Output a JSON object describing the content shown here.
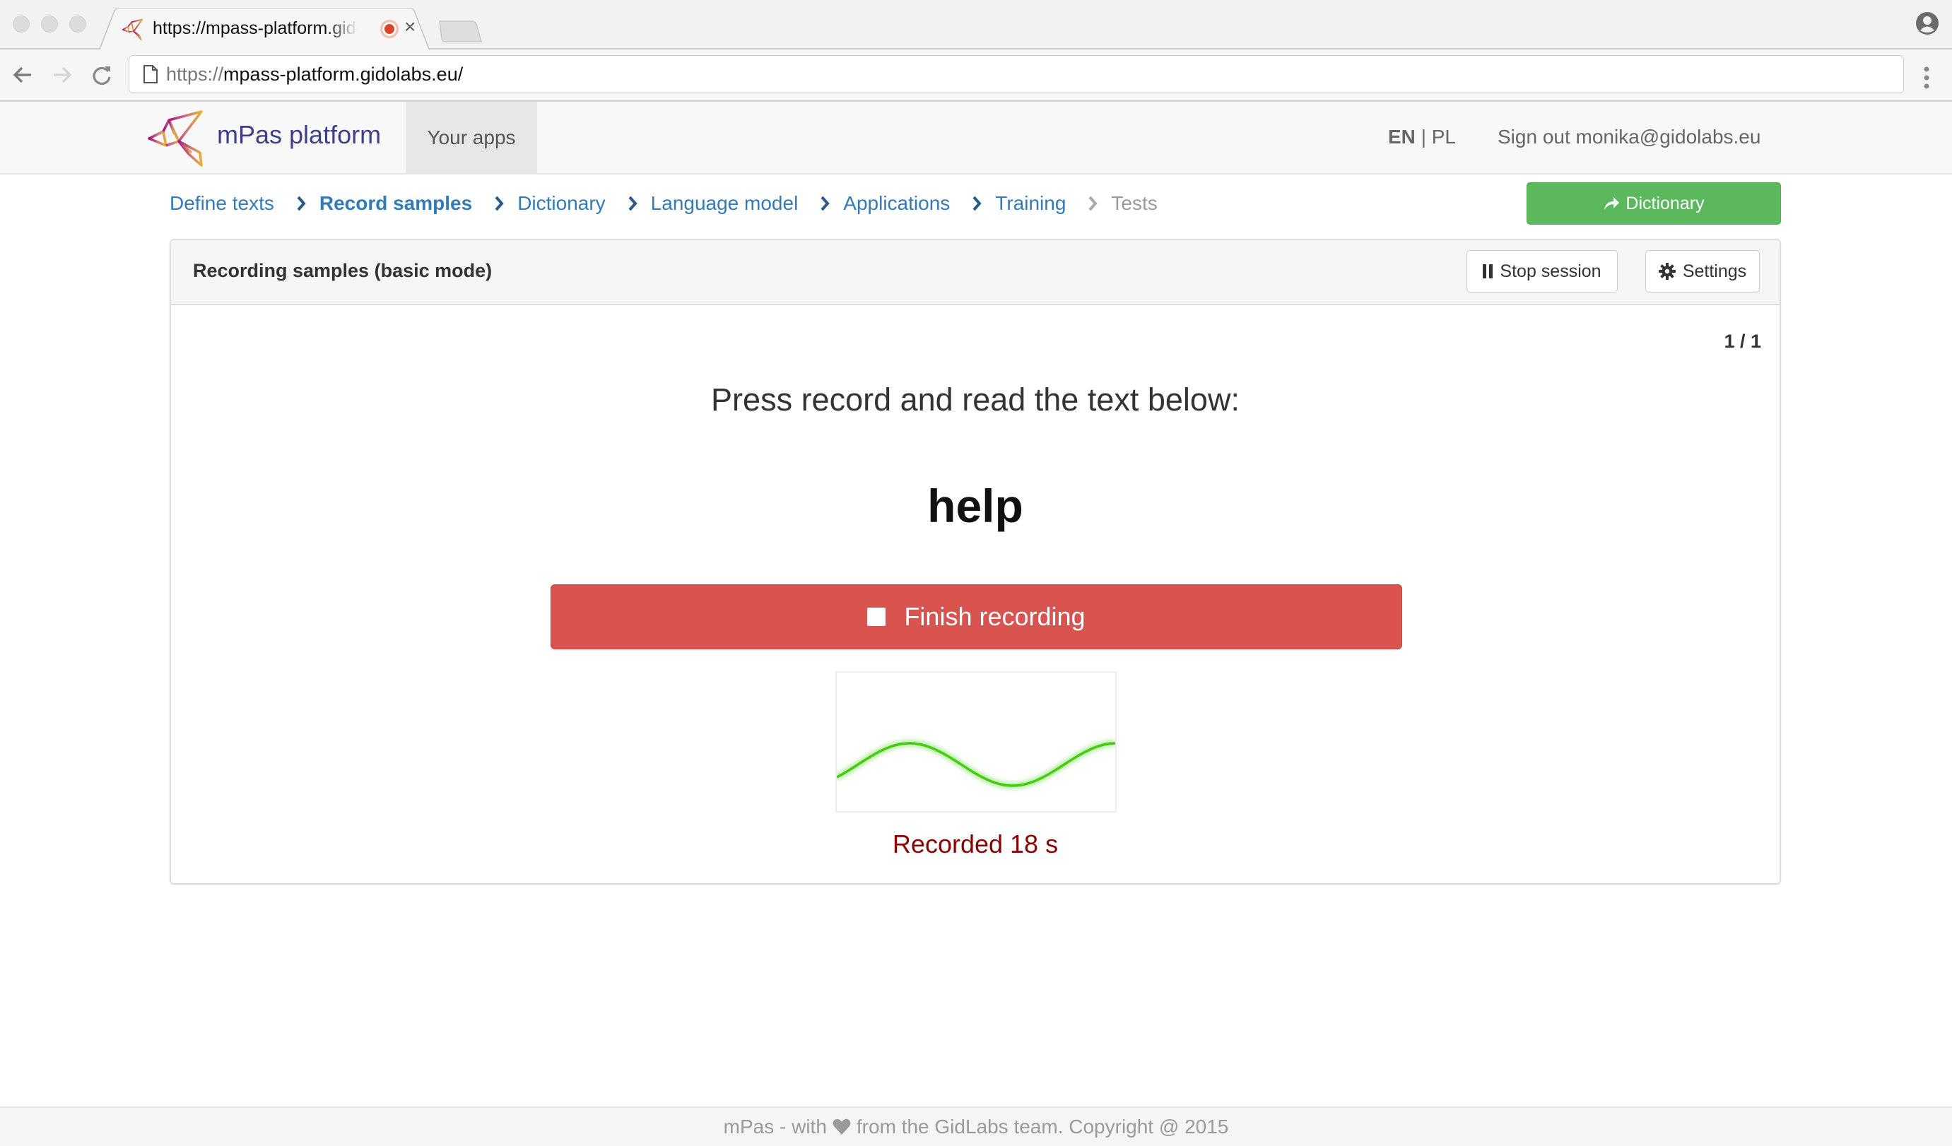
{
  "browser": {
    "tab": {
      "title": "https://mpass-platform.gidolabs.eu/",
      "favicon": "mpas-bird-logo",
      "recording_indicator": "red-record-dot",
      "close_icon": "close-x"
    },
    "address_bar": {
      "scheme": "https://",
      "host": "mpass-platform.gidolabs.eu/",
      "page_icon": "page-icon"
    },
    "nav_icons": [
      "back-arrow",
      "forward-arrow",
      "reload"
    ],
    "profile_icon": "person-circle",
    "menu_icon": "vertical-dots"
  },
  "navbar": {
    "brand": "mPas platform",
    "your_apps": "Your apps",
    "lang_active": "EN",
    "lang_separator": "|",
    "lang_other": "PL",
    "sign_out": "Sign out monika@gidolabs.eu"
  },
  "breadcrumb": {
    "items": [
      {
        "label": "Define texts",
        "state": "link"
      },
      {
        "label": "Record samples",
        "state": "active"
      },
      {
        "label": "Dictionary",
        "state": "link"
      },
      {
        "label": "Language model",
        "state": "link"
      },
      {
        "label": "Applications",
        "state": "link"
      },
      {
        "label": "Training",
        "state": "link"
      },
      {
        "label": "Tests",
        "state": "disabled"
      }
    ],
    "separator_icon": "chevron-right"
  },
  "next_step_button": {
    "label": "Dictionary",
    "icon": "share-arrow",
    "color": "#5cb85c"
  },
  "panel": {
    "title": "Recording samples (basic mode)",
    "stop_session": {
      "label": "Stop session",
      "icon": "pause"
    },
    "settings": {
      "label": "Settings",
      "icon": "gear"
    },
    "counter": "1 / 1",
    "prompt": "Press record and read the text below:",
    "target_word": "help",
    "finish_button": {
      "label": "Finish recording",
      "icon": "stop-square",
      "color": "#d9534f"
    },
    "waveform": {
      "color": "#44cc11"
    },
    "recorded_status": "Recorded 18 s"
  },
  "footer": {
    "before_heart": "mPas - with",
    "heart_icon": "heart",
    "after_heart": "from the GidLabs team. Copyright @ 2015"
  }
}
